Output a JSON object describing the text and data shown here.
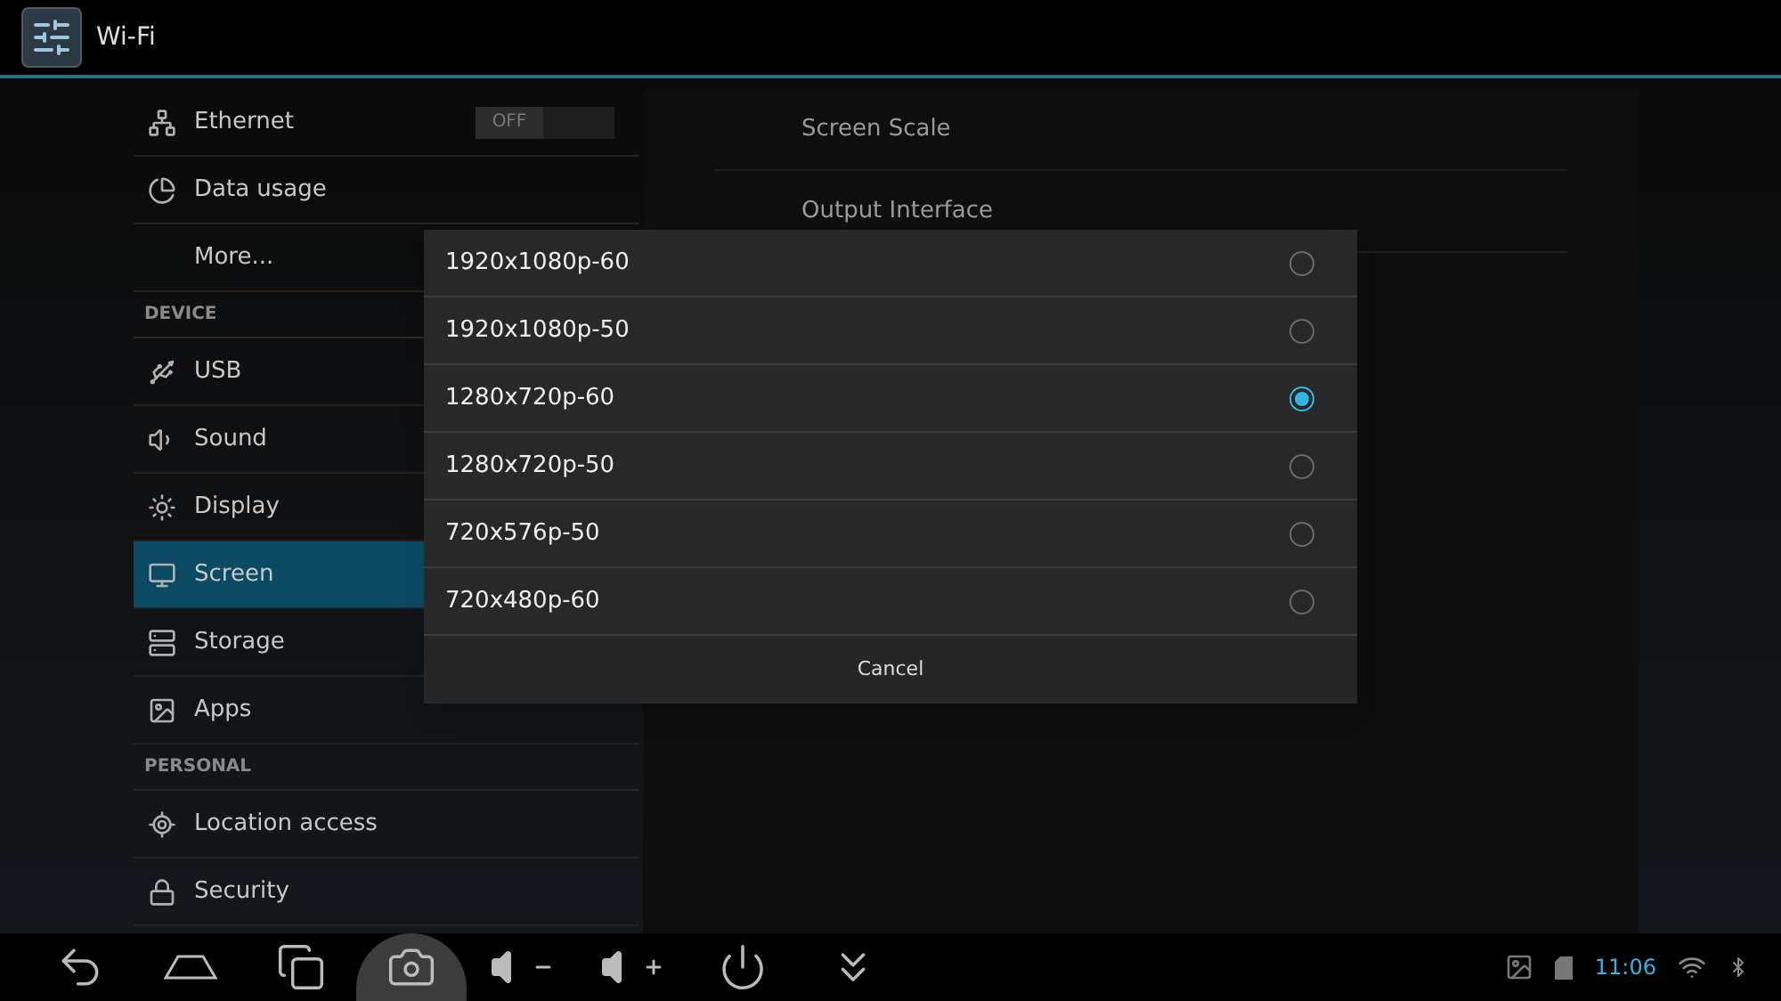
{
  "top_bar": {
    "title": "Wi-Fi"
  },
  "sidebar": {
    "items": [
      {
        "kind": "toggle",
        "label": "Ethernet",
        "toggle_text": "OFF",
        "on": false,
        "selected": false
      },
      {
        "kind": "item",
        "label": "Data usage",
        "selected": false
      },
      {
        "kind": "item",
        "label": "More...",
        "selected": false
      },
      {
        "kind": "header",
        "label": "DEVICE"
      },
      {
        "kind": "item",
        "label": "USB",
        "selected": false
      },
      {
        "kind": "item",
        "label": "Sound",
        "selected": false
      },
      {
        "kind": "item",
        "label": "Display",
        "selected": false
      },
      {
        "kind": "item",
        "label": "Screen",
        "selected": true
      },
      {
        "kind": "item",
        "label": "Storage",
        "selected": false
      },
      {
        "kind": "item",
        "label": "Apps",
        "selected": false
      },
      {
        "kind": "header",
        "label": "PERSONAL"
      },
      {
        "kind": "item",
        "label": "Location access",
        "selected": false
      },
      {
        "kind": "item",
        "label": "Security",
        "selected": false
      }
    ]
  },
  "detail": {
    "items": [
      "Screen Scale",
      "Output Interface"
    ]
  },
  "dialog": {
    "options": [
      {
        "label": "1920x1080p-60",
        "selected": false
      },
      {
        "label": "1920x1080p-50",
        "selected": false
      },
      {
        "label": "1280x720p-60",
        "selected": true
      },
      {
        "label": "1280x720p-50",
        "selected": false
      },
      {
        "label": "720x576p-50",
        "selected": false
      },
      {
        "label": "720x480p-60",
        "selected": false
      }
    ],
    "cancel": "Cancel"
  },
  "nav_bar": {
    "buttons": [
      {
        "selected": false
      },
      {
        "selected": false
      },
      {
        "selected": false
      },
      {
        "selected": true
      },
      {
        "selected": false
      },
      {
        "selected": false
      },
      {
        "selected": false
      },
      {
        "selected": false
      }
    ]
  },
  "status": {
    "time": "11:06"
  }
}
